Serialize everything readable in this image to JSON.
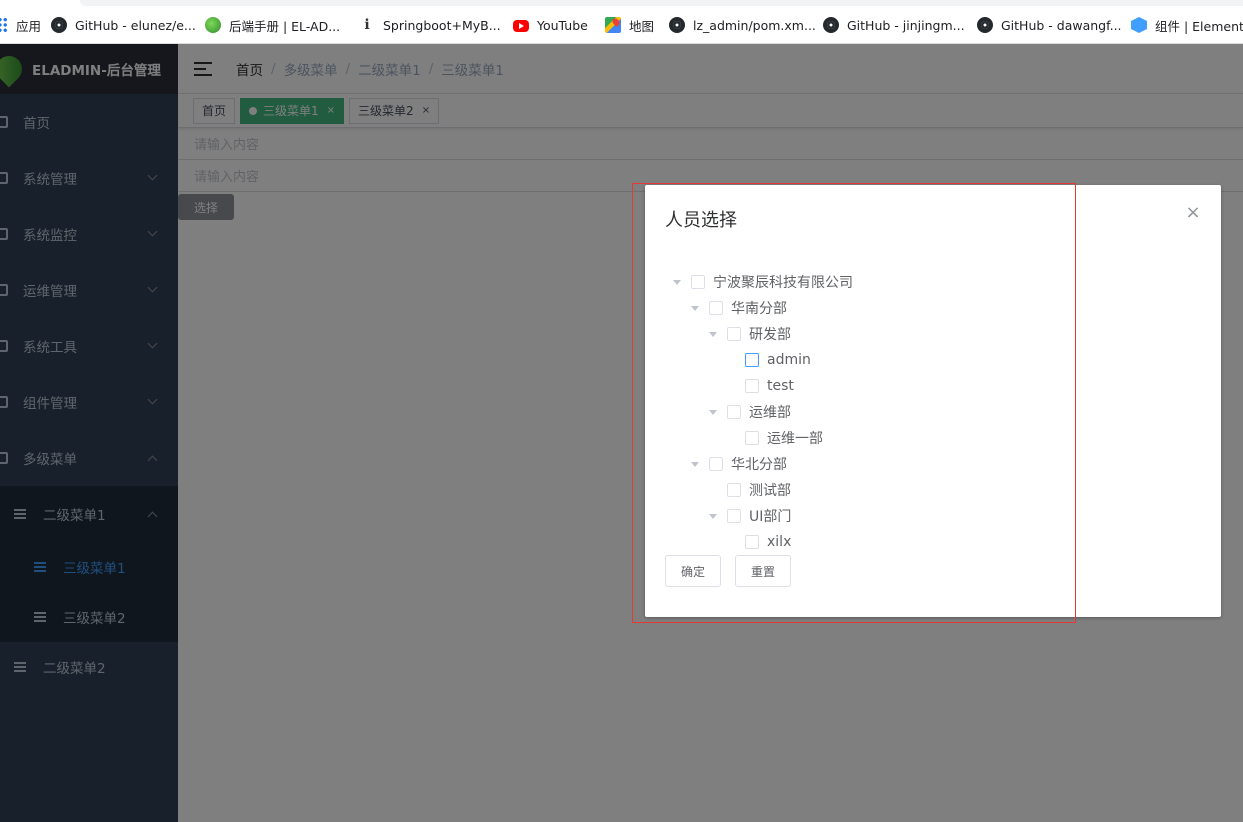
{
  "bookmarks": [
    {
      "label": "应用",
      "icon": "apps-grid-icon"
    },
    {
      "label": "GitHub - elunez/e...",
      "icon": "github-icon"
    },
    {
      "label": "后端手册 | EL-AD...",
      "icon": "leaf-icon"
    },
    {
      "label": "Springboot+MyB...",
      "icon": "site-icon"
    },
    {
      "label": "YouTube",
      "icon": "youtube-icon"
    },
    {
      "label": "地图",
      "icon": "maps-icon"
    },
    {
      "label": "lz_admin/pom.xm...",
      "icon": "github-icon"
    },
    {
      "label": "GitHub - jinjingm...",
      "icon": "github-icon"
    },
    {
      "label": "GitHub - dawangf...",
      "icon": "github-icon"
    },
    {
      "label": "组件 | Element",
      "icon": "element-icon"
    }
  ],
  "sidebar": {
    "logo_title": "ELADMIN-后台管理",
    "items": [
      {
        "label": "首页"
      },
      {
        "label": "系统管理"
      },
      {
        "label": "系统监控"
      },
      {
        "label": "运维管理"
      },
      {
        "label": "系统工具"
      },
      {
        "label": "组件管理"
      },
      {
        "label": "多级菜单"
      }
    ],
    "sub": {
      "level2_1": "二级菜单1",
      "level3_1": "三级菜单1",
      "level3_2": "三级菜单2",
      "level2_2": "二级菜单2"
    }
  },
  "breadcrumb": [
    "首页",
    "多级菜单",
    "二级菜单1",
    "三级菜单1"
  ],
  "tags": [
    {
      "label": "首页"
    },
    {
      "label": "三级菜单1",
      "close": "×"
    },
    {
      "label": "三级菜单2",
      "close": "×"
    }
  ],
  "inputs": {
    "placeholder1": "请输入内容",
    "placeholder2": "请输入内容"
  },
  "select_button": "选择",
  "dialog": {
    "title": "人员选择",
    "close": "×",
    "tree": [
      {
        "label": "宁波聚辰科技有限公司"
      },
      {
        "label": "华南分部"
      },
      {
        "label": "研发部"
      },
      {
        "label": "admin"
      },
      {
        "label": "test"
      },
      {
        "label": "运维部"
      },
      {
        "label": "运维一部"
      },
      {
        "label": "华北分部"
      },
      {
        "label": "测试部"
      },
      {
        "label": "UI部门"
      },
      {
        "label": "xilx"
      }
    ],
    "confirm": "确定",
    "reset": "重置"
  },
  "colors": {
    "accent": "#409eff",
    "tag_active": "#42b983",
    "sidebar_bg": "#304156",
    "annotation_red": "#e53935"
  }
}
